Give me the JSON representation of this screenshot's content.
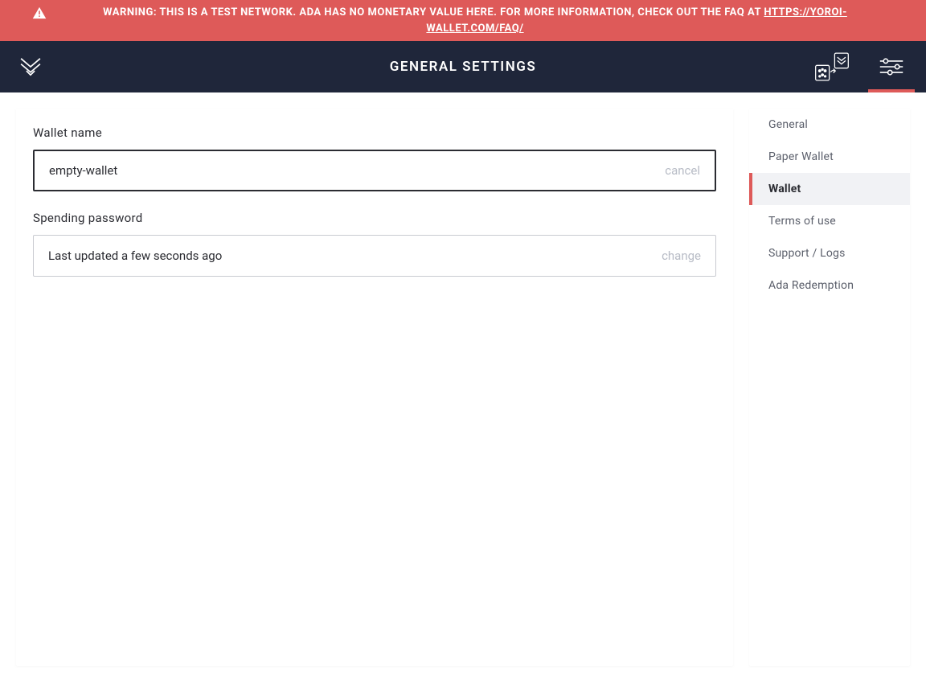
{
  "banner": {
    "text_prefix": "WARNING: THIS IS A TEST NETWORK. ADA HAS NO MONETARY VALUE HERE. FOR MORE INFORMATION, CHECK OUT THE FAQ AT ",
    "link_text": "HTTPS://YOROI-WALLET.COM/FAQ/"
  },
  "header": {
    "title": "GENERAL SETTINGS"
  },
  "main": {
    "wallet_name": {
      "label": "Wallet name",
      "value": "empty-wallet",
      "action": "cancel"
    },
    "spending_password": {
      "label": "Spending password",
      "status": "Last updated a few seconds ago",
      "action": "change"
    }
  },
  "sidebar": {
    "items": [
      {
        "label": "General",
        "active": false
      },
      {
        "label": "Paper Wallet",
        "active": false
      },
      {
        "label": "Wallet",
        "active": true
      },
      {
        "label": "Terms of use",
        "active": false
      },
      {
        "label": "Support / Logs",
        "active": false
      },
      {
        "label": "Ada Redemption",
        "active": false
      }
    ]
  },
  "colors": {
    "accent": "#de5a59",
    "header_bg": "#1f263a"
  }
}
